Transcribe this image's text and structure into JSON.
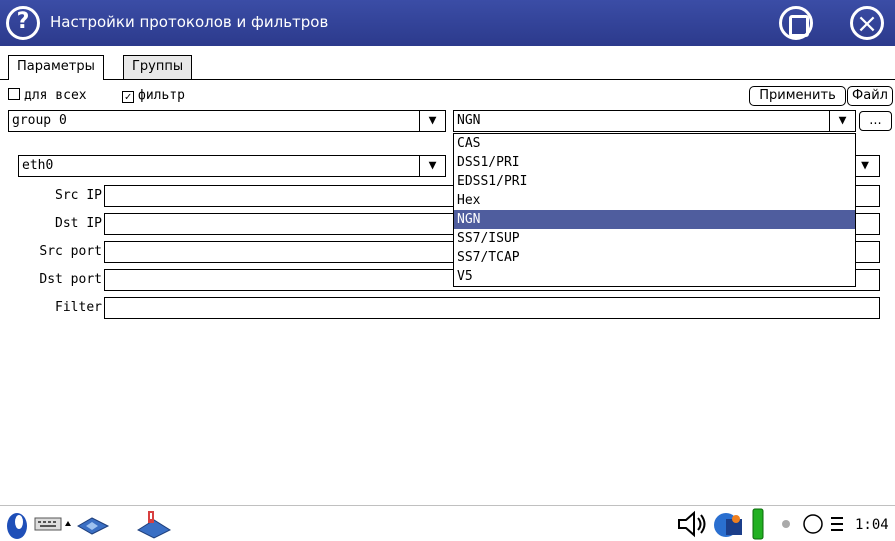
{
  "window": {
    "title": "Настройки протоколов и фильтров"
  },
  "tabs": [
    {
      "label": "Параметры",
      "active": true
    },
    {
      "label": "Группы",
      "active": false
    }
  ],
  "options": {
    "for_all_label": "для всех",
    "for_all_checked": false,
    "filter_label": "фильтр",
    "filter_checked": true
  },
  "buttons": {
    "apply": "Применить",
    "file": "Файл",
    "more": "..."
  },
  "group_combo": {
    "value": "group 0"
  },
  "protocol_combo": {
    "value": "NGN",
    "options": [
      "CAS",
      "DSS1/PRI",
      "EDSS1/PRI",
      "Hex",
      "NGN",
      "SS7/ISUP",
      "SS7/TCAP",
      "V5"
    ],
    "selected": "NGN"
  },
  "interface_combo": {
    "value": "eth0"
  },
  "fields": {
    "src_ip": {
      "label": "Src IP",
      "value": ""
    },
    "dst_ip": {
      "label": "Dst IP",
      "value": ""
    },
    "src_port": {
      "label": "Src port",
      "value": ""
    },
    "dst_port": {
      "label": "Dst port",
      "value": ""
    },
    "filter": {
      "label": "Filter",
      "value": ""
    }
  },
  "taskbar": {
    "clock": "1:04",
    "icons": [
      "start-icon",
      "keyboard-icon",
      "network-icon",
      "phone-icon",
      "speaker-icon",
      "app-icon",
      "battery-icon",
      "dot-icon",
      "circle-icon",
      "menu-icon"
    ]
  },
  "colors": {
    "titlebar": "#2c3a8c",
    "selection": "#4f5d9e"
  }
}
